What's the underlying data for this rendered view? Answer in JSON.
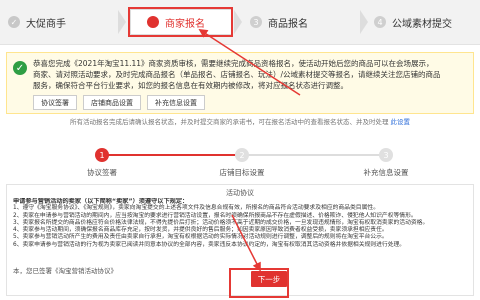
{
  "steps": [
    {
      "label": "大促商手",
      "state": "done"
    },
    {
      "label": "商家报名",
      "state": "active"
    },
    {
      "label": "商品报名",
      "state": "todo",
      "num": "3"
    },
    {
      "label": "公域素材提交",
      "state": "todo",
      "num": "4"
    }
  ],
  "notice": {
    "lines": [
      "恭喜您完成《2021年淘宝11.11》商家资质审核，需要继续完成商品资格报名，使活动开始后您的商品可以在会场展示，",
      "商家、请对照活动要求，及时完成商品报名（单品报名、店铺报名、玩法）/公域素材提交等报名，请继续关注您店铺的商品",
      "服务，确保符合平台行业要求，如您的报名信息在有效期内被修改，将对应报名状态进行调整。"
    ],
    "buttons": [
      "协议签署",
      "店铺商品设置",
      "补充信息设置"
    ]
  },
  "subbanner": {
    "text": "所有活动报名完成后请确认报名状态，并及时提交商家的承诺书，可在报名活动中的查看报名状态、并及时处理",
    "link": "此设置"
  },
  "progress": {
    "nodes": [
      {
        "num": "1",
        "label": "协议签署",
        "state": "on"
      },
      {
        "num": "2",
        "label": "店铺目标设置",
        "state": "off"
      },
      {
        "num": "3",
        "label": "补充信息设置",
        "state": "off"
      }
    ]
  },
  "agreement": {
    "title": "活动协议",
    "heading": "申请参与营销活动的卖家（以下简称“卖家”）须遵守以下规定：",
    "paragraphs": [
      "1、遵守《淘宝服务协议》、《淘宝规则》，卖家向淘宝提交的上述各项文件及信息合规有效，所报名的商品符合活动要求及相应的商品类目属性。",
      "2、卖家在申请参与营销活动的期间内，应当按淘宝的要求进行营销活动设置，报名时须确保所报商品不存在虚假描述、价格欺诈、侵犯他人知识产权等情形。",
      "3、卖家报名所提交的商品价格应符合价格法律法规，不得先提价后打折；活动价格须不高于近期的成交价格，一旦发现违规情形，淘宝有权取消卖家的活动资格。",
      "4、卖家参与活动期间，须确保报名商品库存充足，按时发货，并提供良好的售后服务；如因卖家原因导致消费者权益受损，卖家须承担相应责任。",
      "5、卖家参与营销活动所产生的费用及责任由卖家自行承担，淘宝有权根据活动的实际情况对活动规则进行调整，调整后的规则将在淘宝平台公示。",
      "6、卖家申请参与营销活动的行为视为卖家已阅读并同意本协议的全部内容，卖家违反本协议约定的，淘宝有权取消其活动资格并依据相关规则进行处理。"
    ],
    "footer": "本，您已签署《淘宝营销活动协议》",
    "next_label": "下一步"
  },
  "colors": {
    "accent": "#e0322f",
    "annotation": "#e53935"
  }
}
